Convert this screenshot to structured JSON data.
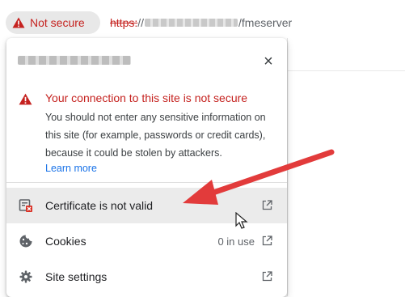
{
  "addressbar": {
    "security_label": "Not secure",
    "url_scheme": "https:",
    "url_separator": "//",
    "url_path": "/fmeserver"
  },
  "popup": {
    "close_glyph": "×",
    "warning": {
      "title": "Your connection to this site is not secure",
      "body": "You should not enter any sensitive information on this site (for example, passwords or credit cards), because it could be stolen by attackers.",
      "link": "Learn more"
    },
    "rows": [
      {
        "label": "Certificate is not valid",
        "meta": "",
        "icon": "certificate-icon"
      },
      {
        "label": "Cookies",
        "meta": "0 in use",
        "icon": "cookie-icon"
      },
      {
        "label": "Site settings",
        "meta": "",
        "icon": "gear-icon"
      }
    ]
  },
  "colors": {
    "danger": "#c5221f",
    "link": "#1a73e8",
    "arrow": "#e23b3b"
  }
}
